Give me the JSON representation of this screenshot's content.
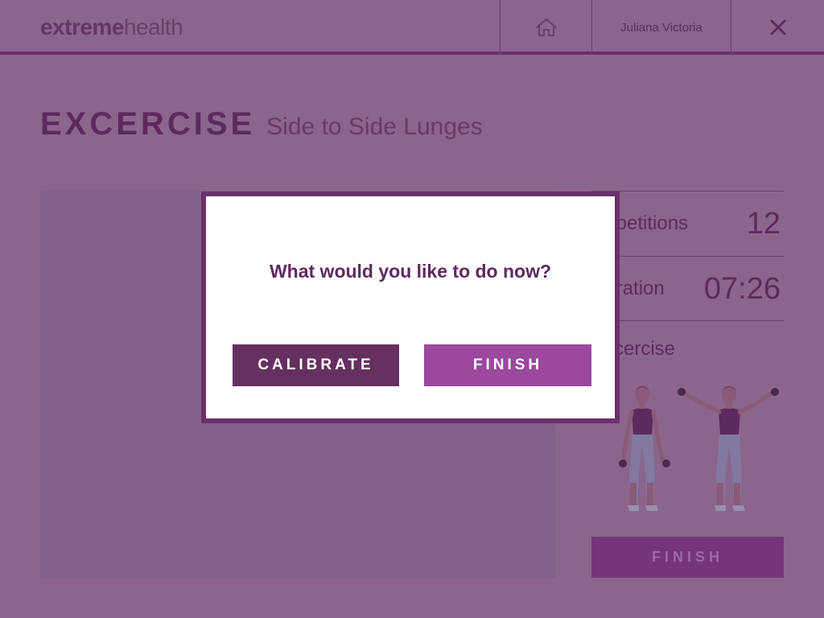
{
  "header": {
    "logo_bold": "extreme",
    "logo_regular": "health",
    "user_name": "Juliana Victoria",
    "icons": {
      "home": "home-icon",
      "close": "close-icon"
    }
  },
  "title": {
    "kind": "EXCERCISE",
    "name": "Side to Side Lunges"
  },
  "stats": {
    "repetitions_label": "Repetitions",
    "repetitions_value": "12",
    "duration_label": "Duration",
    "duration_value": "07:26",
    "exercise_label": "Excercise"
  },
  "bottom_finish_label": "FINISH",
  "modal": {
    "question": "What would you like to do now?",
    "calibrate_label": "CALIBRATE",
    "finish_label": "FINISH"
  },
  "colors": {
    "overlay_background": "#8b658b",
    "brand_dark": "#5e2a5e",
    "button_dark": "#65305f",
    "button_accent": "#9b489e"
  }
}
